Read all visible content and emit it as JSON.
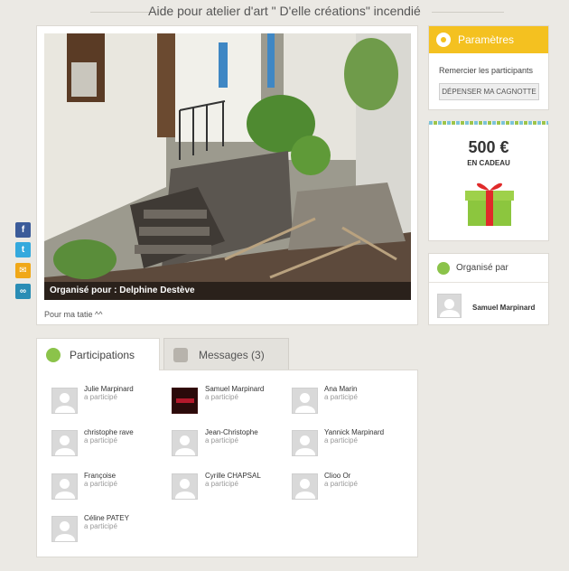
{
  "page": {
    "title": "Aide pour atelier d'art \" D'elle créations\" incendié"
  },
  "campaign": {
    "caption": "Organisé pour : Delphine Destève",
    "description": "Pour ma tatie ^^"
  },
  "share": {
    "facebook": "f",
    "twitter": "t",
    "email": "✉",
    "link": "∞"
  },
  "params": {
    "title": "Paramètres",
    "thanks_link": "Remercier les participants",
    "spend_button": "DÉPENSER MA CAGNOTTE"
  },
  "gift": {
    "amount": "500 €",
    "label": "EN CADEAU"
  },
  "organizer": {
    "title": "Organisé par",
    "name": "Samuel Marpinard"
  },
  "tabs": {
    "participations": "Participations",
    "messages": "Messages (3)"
  },
  "participants": [
    {
      "name": "Julie Marpinard",
      "status": "a participé"
    },
    {
      "name": "Samuel Marpinard",
      "status": "a participé"
    },
    {
      "name": "Ana Marin",
      "status": "a participé"
    },
    {
      "name": "christophe rave",
      "status": "a participé"
    },
    {
      "name": "Jean-Christophe",
      "status": "a participé"
    },
    {
      "name": "Yannick Marpinard",
      "status": "a participé"
    },
    {
      "name": "Françoise",
      "status": "a participé"
    },
    {
      "name": "Cyrille CHAPSAL",
      "status": "a participé"
    },
    {
      "name": "Clioo Or",
      "status": "a participé"
    },
    {
      "name": "Céline PATEY",
      "status": "a participé"
    }
  ],
  "colors": {
    "accent_yellow": "#f4c120",
    "accent_green": "#8bc34a",
    "facebook": "#3b5b99",
    "twitter": "#34a9dd"
  }
}
